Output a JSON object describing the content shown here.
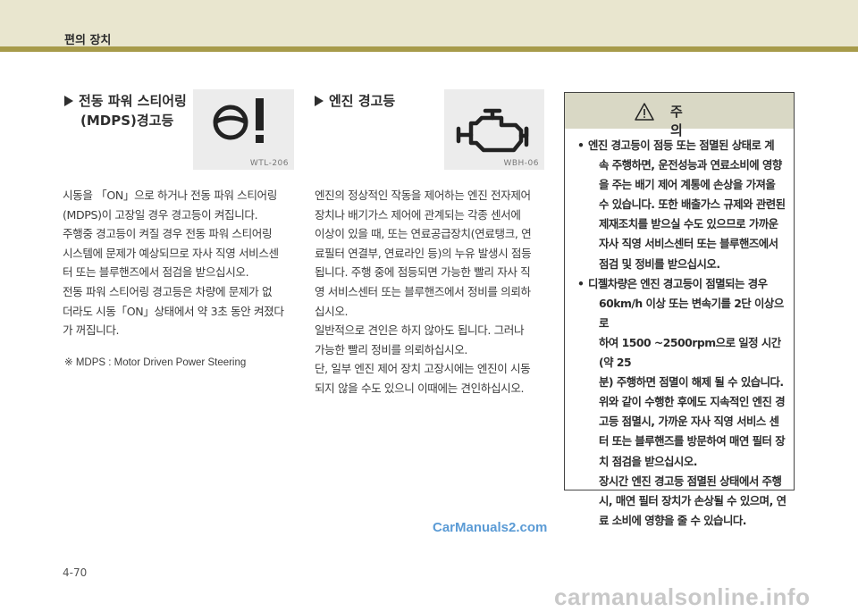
{
  "header": {
    "section_title": "편의 장치"
  },
  "left": {
    "heading_line1": "전동 파워 스티어링",
    "heading_line2": "(MDPS)경고등",
    "icon_caption": "WTL-206",
    "paragraphs": [
      "시동을 「ON」으로 하거나 전동 파워 스티어링",
      "(MDPS)이 고장일 경우 경고등이 켜집니다.",
      "주행중 경고등이 켜질 경우 전동 파워 스티어링",
      "시스템에 문제가 예상되므로 자사 직영 서비스센",
      "터 또는 블루핸즈에서 점검을 받으십시오.",
      "전동 파워 스티어링 경고등은 차량에 문제가 없",
      "더라도 시동「ON」상태에서 약 3초 동안 켜졌다",
      "가 꺼집니다."
    ],
    "note": "※  MDPS :  Motor Driven Power Steering"
  },
  "middle": {
    "heading": "엔진 경고등",
    "icon_caption": "WBH-06",
    "lines": [
      "엔진의 정상적인 작동을 제어하는 엔진 전자제어",
      "장치나 배기가스 제어에 관계되는 각종 센서에",
      "이상이 있을 때, 또는 연료공급장치(연료탱크, 연",
      "료필터 연결부, 연료라인 등)의 누유 발생시 점등",
      "됩니다. 주행 중에 점등되면 가능한 빨리 자사 직",
      "영 서비스센터 또는 블루핸즈에서 정비를 의뢰하",
      "십시오.",
      "일반적으로 견인은 하지 않아도 됩니다. 그러나",
      "가능한 빨리 정비를 의뢰하십시오.",
      "단, 일부 엔진 제어 장치 고장시에는 엔진이 시동",
      "되지 않을 수도 있으니 이때에는 견인하십시오."
    ]
  },
  "caution": {
    "title": "주 의",
    "bullet_symbol": "•",
    "item1_lines": [
      "엔진 경고등이 점등 또는 점멸된 상태로 계",
      "속 주행하면, 운전성능과 연료소비에 영향",
      "을 주는 배기 제어 계통에 손상을 가져올",
      "수 있습니다. 또한 배출가스 규제와 관련된",
      "제재조치를 받으실 수도 있으므로 가까운",
      "자사 직영 서비스센터 또는 블루핸즈에서",
      "점검 및 정비를 받으십시오."
    ],
    "item2_lines": [
      "디젤차량은 엔진 경고등이 점멸되는 경우",
      "60km/h 이상 또는 변속기를 2단 이상으로",
      "하여 1500 ~2500rpm으로 일정 시간(약 25",
      "분) 주행하면 점멸이 해제 될 수 있습니다.",
      "위와 같이 수행한 후에도 지속적인 엔진 경",
      "고등 점멸시, 가까운 자사 직영 서비스 센",
      "터 또는 블루핸즈를 방문하여 매연 필터 장",
      "치 점검을 받으십시오.",
      "장시간 엔진 경고등 점멸된 상태에서 주행",
      "시, 매연 필터 장치가 손상될 수 있으며, 연",
      "료 소비에 영향을 줄 수 있습니다."
    ]
  },
  "footer": {
    "page_number": "4-70"
  },
  "watermarks": {
    "site1": "CarManuals2.com",
    "site2": "carmanualsonline.info"
  }
}
